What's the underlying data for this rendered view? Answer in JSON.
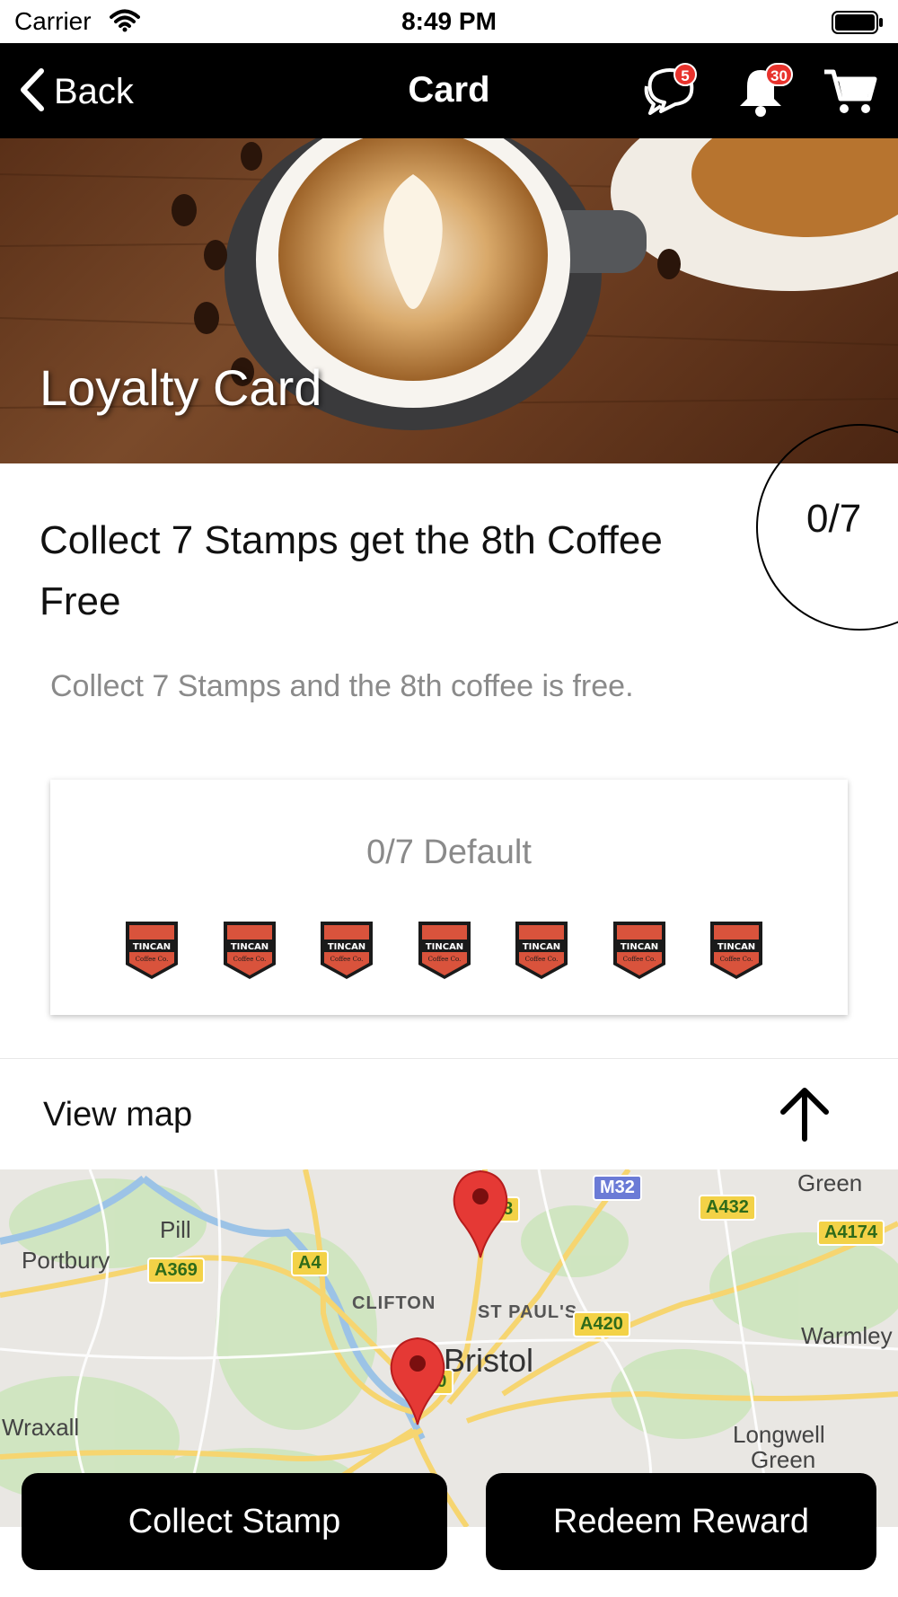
{
  "status_bar": {
    "carrier": "Carrier",
    "time": "8:49 PM"
  },
  "nav": {
    "back_label": "Back",
    "title": "Card",
    "chat_badge": "5",
    "notification_badge": "30",
    "badge_color": "#e8322c"
  },
  "hero": {
    "title": "Loyalty Card"
  },
  "card": {
    "title": "Collect 7 Stamps get the 8th Coffee Free",
    "progress": "0/7",
    "description": "Collect 7 Stamps and the 8th coffee is free.",
    "stamp_card_label": "0/7 Default",
    "stamps": [
      {
        "brand": "TINCAN",
        "sub": "Coffee Co."
      },
      {
        "brand": "TINCAN",
        "sub": "Coffee Co."
      },
      {
        "brand": "TINCAN",
        "sub": "Coffee Co."
      },
      {
        "brand": "TINCAN",
        "sub": "Coffee Co."
      },
      {
        "brand": "TINCAN",
        "sub": "Coffee Co."
      },
      {
        "brand": "TINCAN",
        "sub": "Coffee Co."
      },
      {
        "brand": "TINCAN",
        "sub": "Coffee Co."
      }
    ]
  },
  "map_section": {
    "label": "View map",
    "places": [
      "Green",
      "Pill",
      "Portbury",
      "CLIFTON",
      "ST PAUL'S",
      "Bristol",
      "Warmley",
      "Wraxall",
      "Longwell",
      "Green"
    ],
    "roads": [
      "M32",
      "A432",
      "A4174",
      "A369",
      "A4",
      "A420",
      "370",
      "8"
    ]
  },
  "actions": {
    "collect_label": "Collect Stamp",
    "redeem_label": "Redeem Reward"
  }
}
